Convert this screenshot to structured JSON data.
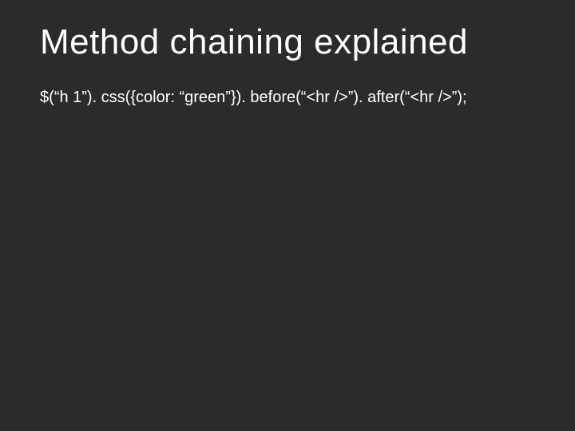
{
  "slide": {
    "title": "Method chaining explained",
    "code": "$(“h 1”). css({color: “green”}). before(“<hr />”). after(“<hr />”);"
  }
}
